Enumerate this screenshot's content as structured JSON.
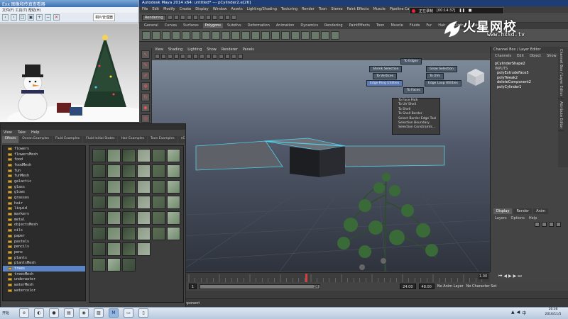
{
  "viewer": {
    "title": "Exx 图像和传真查看器",
    "menu": "文件(F)  工具(T)  帮助(H)",
    "toolbar_label": "相片管理器"
  },
  "maya": {
    "title": "Autodesk Maya 2014 x64: untitled*   ---   pCylinder2.e[26]",
    "menu": [
      "File",
      "Edit",
      "Modify",
      "Create",
      "Display",
      "Window",
      "Assets",
      "Lighting/Shading",
      "Texturing",
      "Render",
      "Toon",
      "Stereo",
      "Paint Effects",
      "Muscle",
      "Pipeline Cache",
      "Help"
    ],
    "mode": "Rendering",
    "shelf_tabs": [
      "General",
      "Curves",
      "Surfaces",
      "Polygons",
      "Subdivs",
      "Deformation",
      "Animation",
      "Dynamics",
      "Rendering",
      "PaintEffects",
      "Toon",
      "Muscle",
      "Fluids",
      "Fur",
      "Hair",
      "nCloth",
      "Custom"
    ],
    "shelf_active": "Polygons",
    "viewport_menu": [
      "View",
      "Shading",
      "Lighting",
      "Show",
      "Renderer",
      "Panels"
    ],
    "marking_menu": {
      "to_edges": "To Edges",
      "shrink": "Shrink Selection",
      "grow": "Grow Selection",
      "to_vertices": "To Vertices",
      "to_uvs": "To UVs",
      "edge_ring": "Edge Ring Utilities",
      "edge_loop": "Edge Loop Utilities",
      "to_faces": "To Faces",
      "list": [
        "To Face Path",
        "To UV Shell",
        "To Shell",
        "To Shell Border",
        "Select Border Edge Tool",
        "Selection Boundary",
        "Selection Constraints..."
      ]
    },
    "channel_box": {
      "title": "Channel Box / Layer Editor",
      "menu": [
        "Channels",
        "Edit",
        "Object",
        "Show"
      ],
      "shape": "pCylinderShape2",
      "inputs_label": "INPUTS",
      "nodes": [
        "polyExtrudeFace5",
        "polyTweak2",
        "deleteComponent2",
        "polyCylinder1"
      ]
    },
    "side_tabs": [
      "Channel Box / Layer Editor",
      "Attribute Editor"
    ],
    "layer": {
      "tabs": [
        "Display",
        "Render",
        "Anim"
      ],
      "active": "Display",
      "menu": [
        "Layers",
        "Options",
        "Help"
      ]
    },
    "timeline": {
      "start": "1",
      "current": "24",
      "range_start_field": "1.00",
      "range_end": "24.00",
      "end": "48.00",
      "anim_layer": "No Anim Layer",
      "character": "No Character Set",
      "tick_label": "24"
    },
    "help_line": "Select Tool: select a component"
  },
  "recorder": {
    "status": "正在录制",
    "time": "[00:14:37]"
  },
  "visor": {
    "menu": [
      "View",
      "Take",
      "Help"
    ],
    "tabs": [
      "Effects",
      "Ocean Examples",
      "Fluid Examples",
      "Fluid Initial States",
      "Hair Examples",
      "Toon Examples",
      "nCloth"
    ],
    "active_tab": "Effects",
    "folders": [
      "flowers",
      "flowersMesh",
      "food",
      "foodMesh",
      "fun",
      "funMesh",
      "galactic",
      "glass",
      "glows",
      "grasses",
      "hair",
      "liquid",
      "markers",
      "metal",
      "objectsMesh",
      "oils",
      "paper",
      "pastels",
      "pencils",
      "pens",
      "plants",
      "plantsMesh",
      "trees",
      "treesMesh",
      "underwater",
      "waterMesh",
      "watercolor"
    ],
    "selected": "trees"
  },
  "watermark": {
    "text": "火星网校",
    "url": "www.hxsd.tv"
  },
  "taskbar": {
    "start": "开始",
    "clock_time": "16:36",
    "clock_date": "2016/11/5"
  },
  "colors": {
    "selection_blue": "#5a84c6",
    "highlight_cyan": "#4fd1e8",
    "maya_title": "#1e3d74"
  }
}
